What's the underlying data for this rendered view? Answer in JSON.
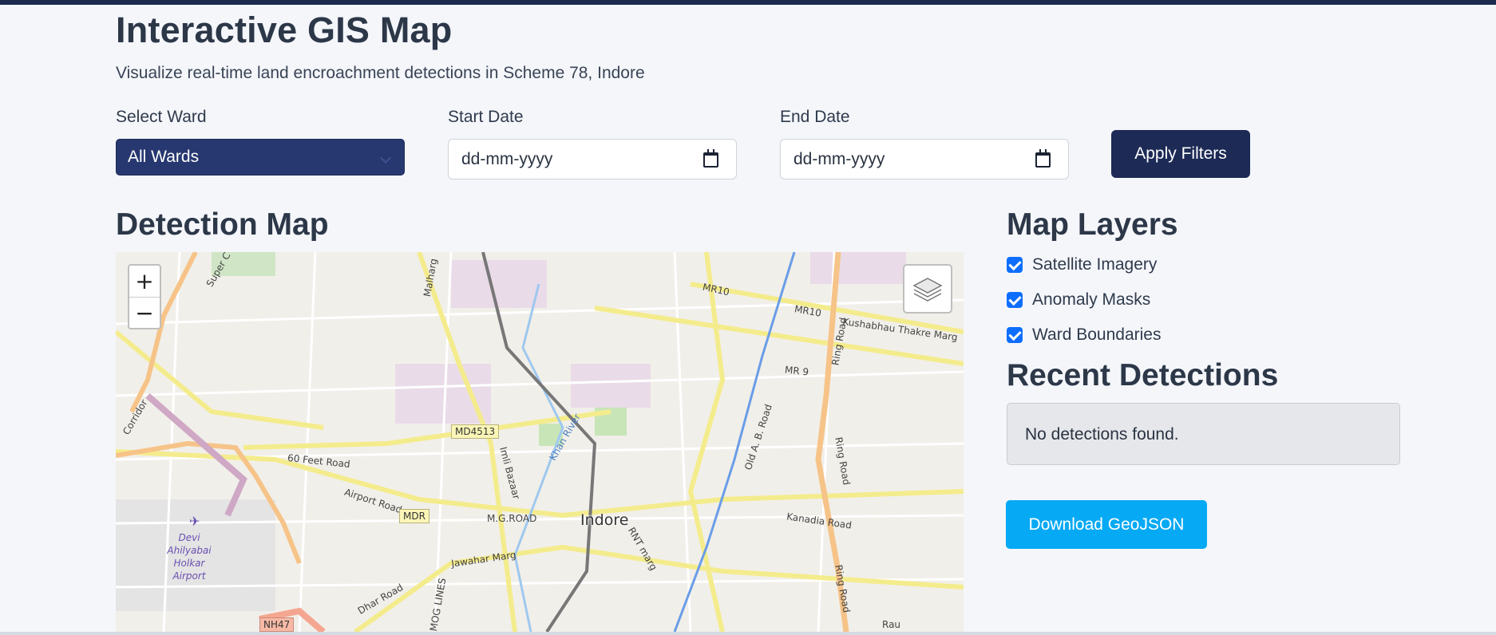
{
  "header": {
    "title": "Interactive GIS Map",
    "subtitle": "Visualize real-time land encroachment detections in Scheme 78, Indore"
  },
  "filters": {
    "ward_label": "Select Ward",
    "ward_value": "All Wards",
    "start_label": "Start Date",
    "start_placeholder": "dd-mm-yyyy",
    "end_label": "End Date",
    "end_placeholder": "dd-mm-yyyy",
    "apply_label": "Apply Filters"
  },
  "map": {
    "title": "Detection Map",
    "zoom_in": "+",
    "zoom_out": "−",
    "labels": {
      "city": "Indore",
      "mr10a": "MR10",
      "mr10b": "MR10",
      "kushabhau": "Kushabhau Thakre Marg",
      "ring_road_1": "Ring Road",
      "ring_road_2": "Ring Road",
      "ring_road_3": "Ring Road",
      "mr9": "MR 9",
      "md4513": "MD4513",
      "sixty_feet": "60 Feet Road",
      "airport_road": "Airport Road",
      "mdr": "MDR",
      "mg_road": "M.G.ROAD",
      "jawahar": "Jawahar Marg",
      "dhar": "Dhar Road",
      "nh47": "NH47",
      "airport": "Devi Ahilyabai Holkar Airport",
      "kanadia": "Kanadia Road",
      "old_ab": "Old A. B. Road",
      "rnt": "RNT marg",
      "imli": "Imli Bazaar",
      "corridor": "Corridor",
      "super_c": "Super C",
      "malharg": "Malharg",
      "mog_lines": "MOG LINES",
      "khan_river": "Khan River",
      "rau": "Rau"
    }
  },
  "layers": {
    "title": "Map Layers",
    "items": [
      {
        "label": "Satellite Imagery",
        "checked": true
      },
      {
        "label": "Anomaly Masks",
        "checked": true
      },
      {
        "label": "Ward Boundaries",
        "checked": true
      }
    ]
  },
  "detections": {
    "title": "Recent Detections",
    "empty_text": "No detections found."
  },
  "download": {
    "label": "Download GeoJSON"
  },
  "colors": {
    "primary_dark": "#1c2a55",
    "select_bg": "#26386f",
    "checkbox": "#0d6efd",
    "download": "#06a9f4"
  }
}
